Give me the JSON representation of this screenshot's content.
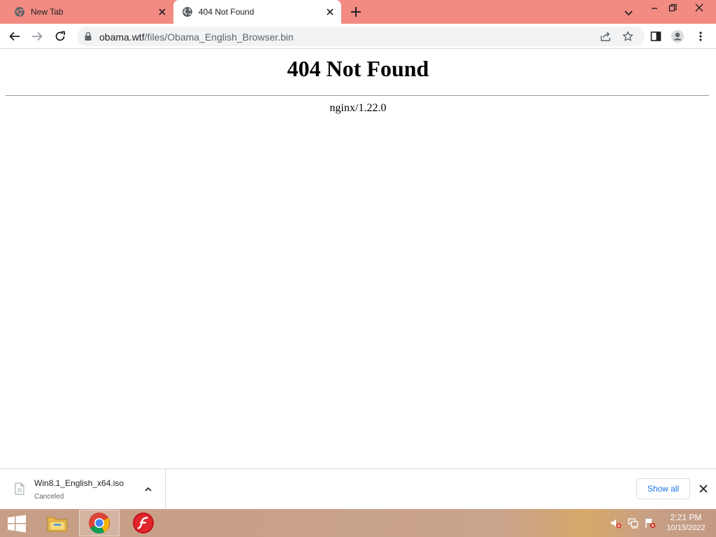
{
  "browser": {
    "tabs": [
      {
        "title": "New Tab",
        "favicon": "chrome-icon",
        "active": false
      },
      {
        "title": "404 Not Found",
        "favicon": "globe-icon",
        "active": true
      }
    ],
    "address_bar": {
      "host": "obama.wtf",
      "path": "/files/Obama_English_Browser.bin"
    }
  },
  "page": {
    "heading": "404 Not Found",
    "server": "nginx/1.22.0"
  },
  "downloads": {
    "item": {
      "filename": "Win8.1_English_x64.iso",
      "status": "Canceled"
    },
    "show_all_label": "Show all"
  },
  "taskbar": {
    "apps": [
      "file-explorer-icon",
      "chrome-icon",
      "flash-icon"
    ],
    "clock": {
      "time": "2:21 PM",
      "date": "10/15/2022"
    }
  },
  "colors": {
    "tabstrip": "#f28b82",
    "accent": "#1a73e8"
  }
}
